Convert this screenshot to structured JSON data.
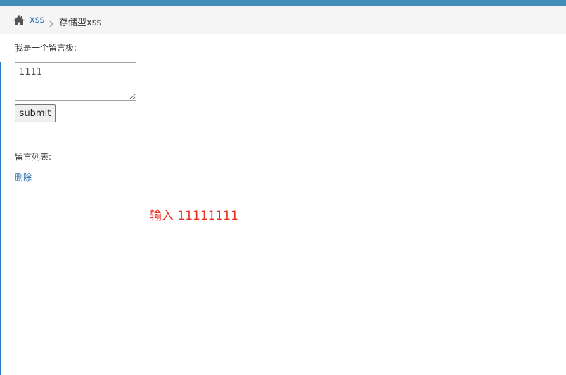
{
  "breadcrumb": {
    "home_icon": "home-icon",
    "link_label": "xss",
    "separator_icon": "chevron-right-icon",
    "current_label": "存储型xss"
  },
  "form": {
    "title": "我是一个留言板:",
    "textarea_value": "1111",
    "submit_label": "submit"
  },
  "messages": {
    "title": "留言列表:",
    "delete_label": "删除"
  },
  "annotation": {
    "text": "输入 11111111"
  },
  "colors": {
    "topbar": "#438eb9",
    "link": "#2a6fad",
    "annotation": "#e8301e"
  }
}
